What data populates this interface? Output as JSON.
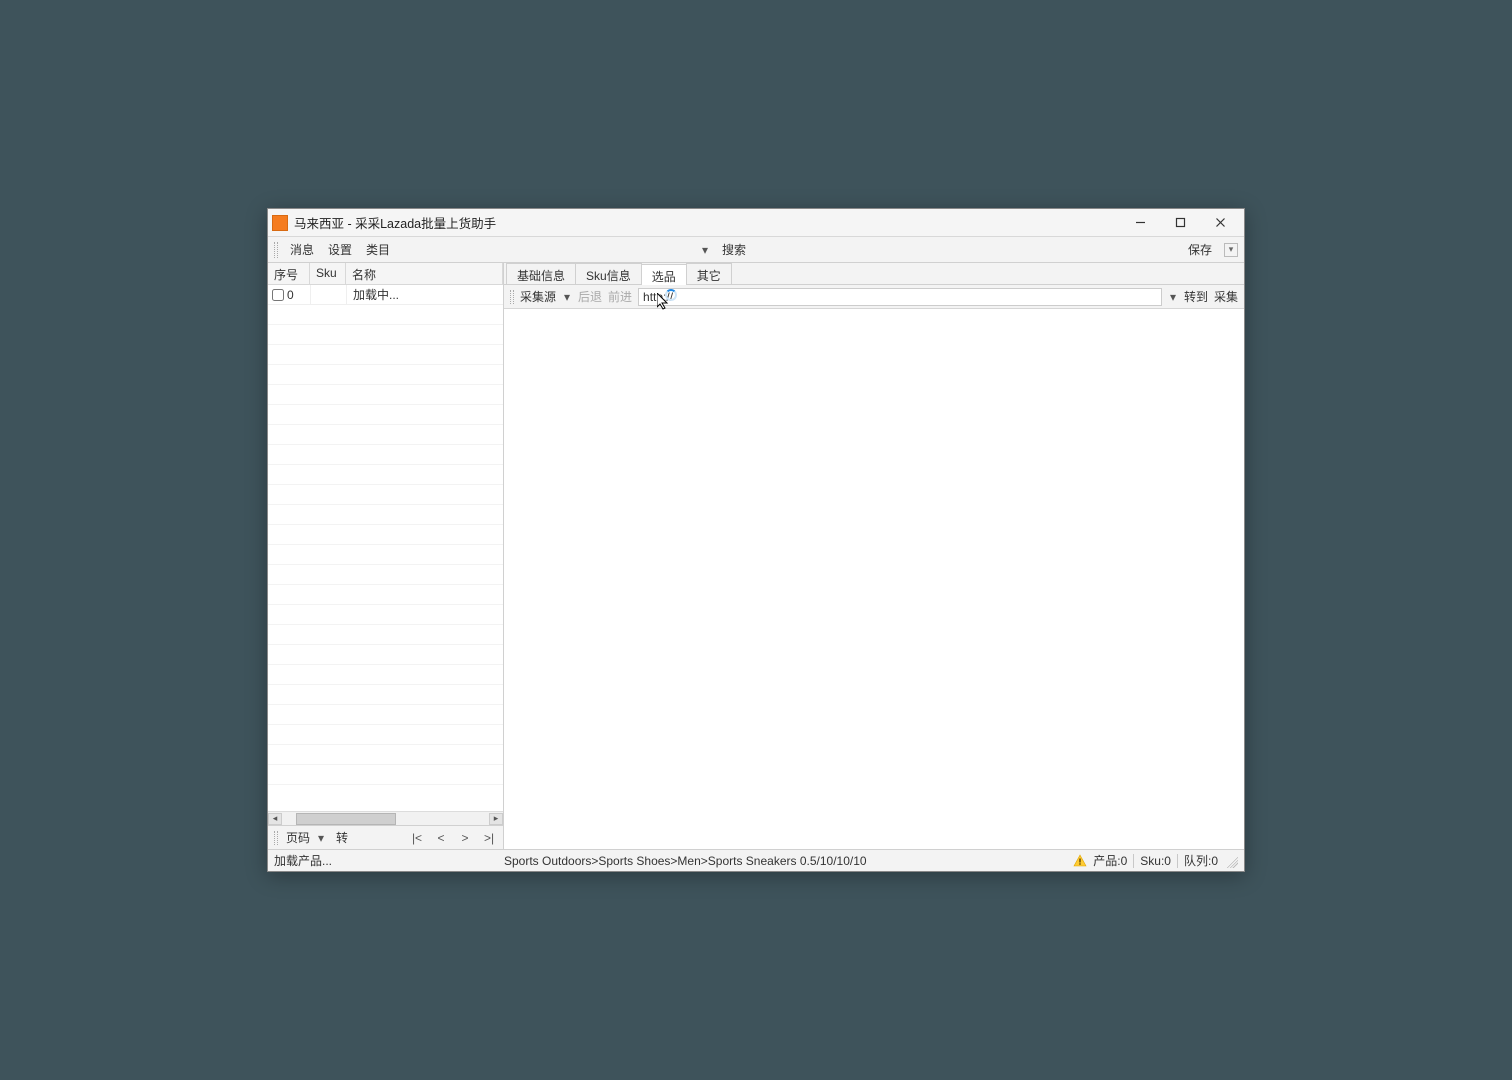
{
  "window": {
    "title": "马来西亚 - 采采Lazada批量上货助手"
  },
  "menu": {
    "items": [
      "消息",
      "设置",
      "类目"
    ],
    "search_label": "搜索",
    "save_label": "保存"
  },
  "left": {
    "columns": {
      "seq": "序号",
      "sku": "Sku",
      "name": "名称"
    },
    "rows": [
      {
        "seq": "0",
        "sku": "",
        "name": "加载中..."
      }
    ],
    "pager": {
      "page_label": "页码",
      "convert_label": "转",
      "first": "|<",
      "prev": "<",
      "next": ">",
      "last": ">|"
    }
  },
  "tabs": {
    "items": [
      "基础信息",
      "Sku信息",
      "选品",
      "其它"
    ],
    "active_index": 2
  },
  "browser": {
    "source_label": "采集源",
    "back_label": "后退",
    "forward_label": "前进",
    "url_value": "http://",
    "goto_label": "转到",
    "collect_label": "采集"
  },
  "status": {
    "left": "加载产品...",
    "center": "Sports  Outdoors>Sports Shoes>Men>Sports Sneakers   0.5/10/10/10",
    "product": "产品:0",
    "sku": "Sku:0",
    "queue": "队列:0"
  }
}
